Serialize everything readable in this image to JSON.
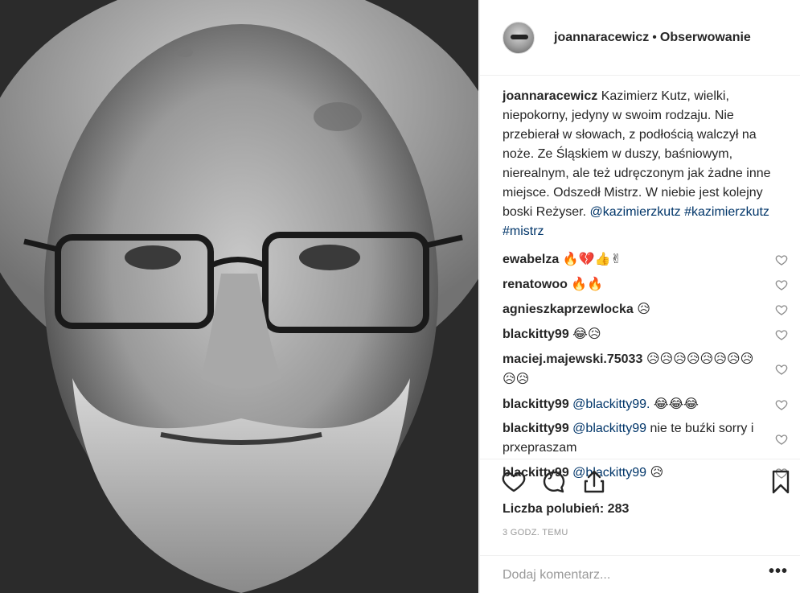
{
  "post": {
    "photo_alt": "",
    "header": {
      "username": "joannaracewicz",
      "separator": "•",
      "follow_label": "Obserwowanie"
    },
    "caption": {
      "username": "joannaracewicz",
      "text": "Kazimierz Kutz, wielki, niepokorny, jedyny w swoim rodzaju. Nie przebierał w słowach, z podłością walczył na noże. Ze Śląskiem w duszy, baśniowym, nierealnym, ale też udręczonym jak żadne inne miejsce. Odszedł Mistrz. W niebie jest kolejny boski Reżyser.",
      "mention": "@kazimierzkutz",
      "hashtags": "#kazimierzkutz #mistrz"
    },
    "comments": [
      {
        "username": "ewabelza",
        "mention": "",
        "text": "🔥💔👍✌"
      },
      {
        "username": "renatowoo",
        "mention": "",
        "text": "🔥🔥"
      },
      {
        "username": "agnieszkaprzewlocka",
        "mention": "",
        "text": "😥"
      },
      {
        "username": "blackitty99",
        "mention": "",
        "text": "😂😥"
      },
      {
        "username": "maciej.majewski.75033",
        "mention": "",
        "text": "😥😥😥😥😥😥😥😥😥😥"
      },
      {
        "username": "blackitty99",
        "mention": "@blackitty99.",
        "text": "😂😂😂"
      },
      {
        "username": "blackitty99",
        "mention": "@blackitty99",
        "text": "nie te buźki sorry i prxepraszam"
      },
      {
        "username": "blackitty99",
        "mention": "@blackitty99",
        "text": "😥"
      }
    ],
    "likes_text": "Liczba polubień: 283",
    "time_text": "3 GODZ. TEMU",
    "add_comment_placeholder": "Dodaj komentarz...",
    "more_label": "•••"
  }
}
